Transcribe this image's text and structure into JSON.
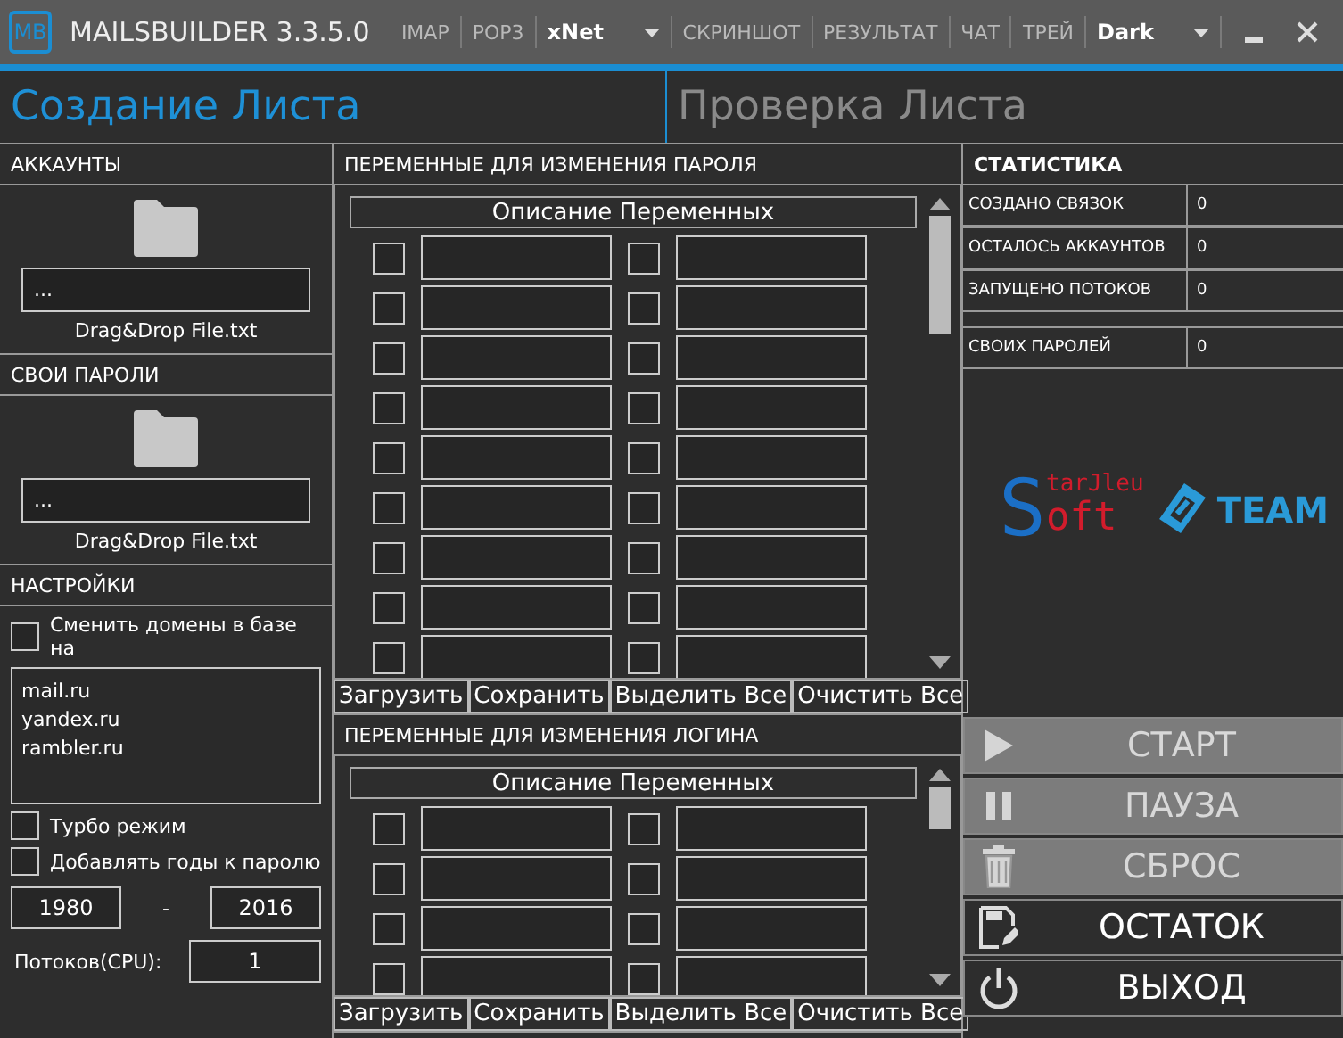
{
  "window": {
    "title": "MAILSBUILDER 3.3.5.0",
    "logo": "MB"
  },
  "menu": [
    {
      "kind": "link",
      "label": "IMAP"
    },
    {
      "kind": "link",
      "label": "POP3"
    },
    {
      "kind": "dropdown",
      "label": "xNet"
    },
    {
      "kind": "link",
      "label": "СКРИНШОТ"
    },
    {
      "kind": "link",
      "label": "РЕЗУЛЬТАТ"
    },
    {
      "kind": "link",
      "label": "ЧАТ"
    },
    {
      "kind": "link",
      "label": "ТРЕЙ"
    },
    {
      "kind": "dropdown",
      "label": "Dark"
    }
  ],
  "tabs": [
    {
      "label": "Создание Листа",
      "selected": true
    },
    {
      "label": "Проверка Листа",
      "selected": false
    }
  ],
  "files": [
    {
      "title": "АККАУНТЫ",
      "path": "...",
      "caption": "Drag&Drop File.txt"
    },
    {
      "title": "СВОИ ПАРОЛИ",
      "path": "...",
      "caption": "Drag&Drop File.txt"
    }
  ],
  "settings": {
    "title": "НАСТРОЙКИ",
    "replace_domains": {
      "label": "Сменить домены в базе на",
      "checked": false
    },
    "domains": [
      "mail.ru",
      "yandex.ru",
      "rambler.ru"
    ],
    "turbo": {
      "label": "Турбо режим",
      "checked": false
    },
    "add_years": {
      "label": "Добавлять годы к паролю",
      "checked": false
    },
    "year_from": "1980",
    "year_sep": "-",
    "year_to": "2016",
    "threads_label": "Потоков(CPU):",
    "threads": "1"
  },
  "var_panels": [
    {
      "title": "ПЕРЕМЕННЫЕ ДЛЯ ИЗМЕНЕНИЯ ПАРОЛЯ",
      "header": "Описание Переменных",
      "rows": [
        {
          "left_checked": false,
          "right_checked": false
        },
        {
          "left_checked": false,
          "right_checked": false
        },
        {
          "left_checked": false,
          "right_checked": false
        },
        {
          "left_checked": false,
          "right_checked": false
        },
        {
          "left_checked": false,
          "right_checked": false
        },
        {
          "left_checked": false,
          "right_checked": false
        },
        {
          "left_checked": false,
          "right_checked": false
        },
        {
          "left_checked": false,
          "right_checked": false
        },
        {
          "left_checked": false,
          "right_checked": false
        }
      ],
      "buttons": [
        "Загрузить",
        "Сохранить",
        "Выделить Все",
        "Очистить Все"
      ]
    },
    {
      "title": "ПЕРЕМЕННЫЕ ДЛЯ ИЗМЕНЕНИЯ ЛОГИНА",
      "header": "Описание Переменных",
      "rows": [
        {
          "left_checked": false,
          "right_checked": false
        },
        {
          "left_checked": false,
          "right_checked": false
        },
        {
          "left_checked": false,
          "right_checked": false
        },
        {
          "left_checked": false,
          "right_checked": false
        }
      ],
      "buttons": [
        "Загрузить",
        "Сохранить",
        "Выделить Все",
        "Очистить Все"
      ]
    }
  ],
  "stats": {
    "title": "СТАТИСТИКА",
    "rows": [
      {
        "label": "СОЗДАНО СВЯЗОК",
        "value": "0"
      },
      {
        "label": "ОСТАЛОСЬ АККАУНТОВ",
        "value": "0"
      },
      {
        "label": "ЗАПУЩЕНО ПОТОКОВ",
        "value": "0"
      },
      {
        "label": "СВОИХ ПАРОЛЕЙ",
        "value": "0"
      }
    ]
  },
  "logos": {
    "star_big": "S",
    "star_top": "tarJleu",
    "star_bottom": "oft",
    "team": "TEAM"
  },
  "actions": [
    {
      "kind": "play",
      "label": "СТАРТ",
      "disabled": true
    },
    {
      "kind": "pause",
      "label": "ПАУЗА",
      "disabled": true
    },
    {
      "kind": "trash",
      "label": "СБРОС",
      "disabled": true
    },
    {
      "kind": "save",
      "label": "ОСТАТОК",
      "disabled": false
    },
    {
      "kind": "power",
      "label": "ВЫХОД",
      "disabled": false
    }
  ]
}
